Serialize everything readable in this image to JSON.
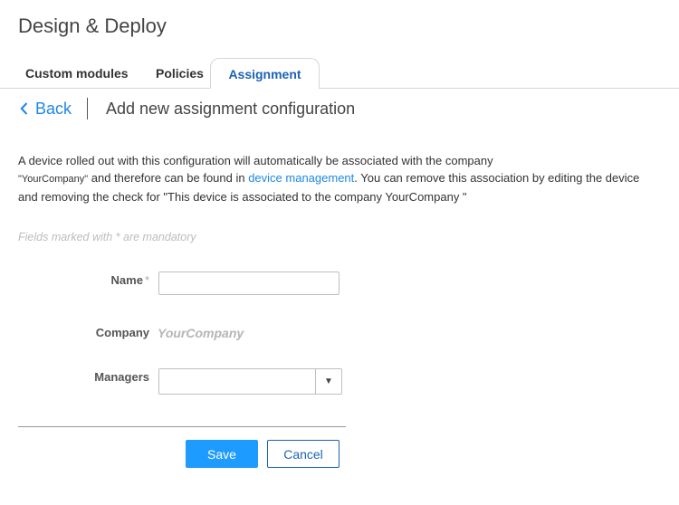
{
  "app": {
    "title": "Design & Deploy"
  },
  "tabs": [
    {
      "label": "Custom modules"
    },
    {
      "label": "Policies"
    },
    {
      "label": "Assignment",
      "active": true
    }
  ],
  "nav": {
    "back_label": "Back",
    "subtitle": "Add new assignment configuration"
  },
  "description": {
    "line1": "A device rolled out with this configuration will automatically be associated with the company",
    "company_quoted": "\"YourCompany\"",
    "text2": " and therefore can be found in ",
    "link": "device management",
    "text3": ". You can remove this association by editing the device and removing the check for \"This device is associated to the company  YourCompany \""
  },
  "form": {
    "mandatory_note": "Fields marked with * are mandatory",
    "name_label": "Name",
    "required_mark": "*",
    "name_value": "",
    "company_label": "Company",
    "company_value": "YourCompany",
    "managers_label": "Managers",
    "managers_value": "",
    "dropdown_arrow": "▼"
  },
  "buttons": {
    "save": "Save",
    "cancel": "Cancel"
  },
  "colors": {
    "accent": "#1e88e5",
    "primary_button": "#1e9bff",
    "tab_active": "#1b63b4"
  }
}
